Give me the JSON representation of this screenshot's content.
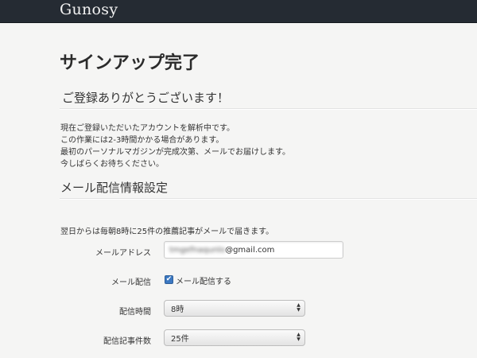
{
  "header": {
    "brand": "Gunosy"
  },
  "main": {
    "title": "サインアップ完了",
    "welcome": "ご登録ありがとうございます！",
    "intro_lines": [
      "現在ご登録いただいたアカウントを解析中です。",
      "この作業には2-3時間かかる場合があります。",
      "最初のパーソナルマガジンが完成次第、メールでお届けします。",
      "今しばらくお待ちください。"
    ],
    "mail_section_title": "メール配信情報設定",
    "mail_notice": "翌日からは毎朝8時に25件の推薦記事がメールで届きます。"
  },
  "form": {
    "email_label": "メールアドレス",
    "email_value_hidden": "tmgefnaqunlo",
    "email_value_domain": "@gmail.com",
    "delivery_label": "メール配信",
    "delivery_checkbox_label": "メール配信する",
    "delivery_checked": true,
    "time_label": "配信時間",
    "time_value": "8時",
    "count_label": "配信記事件数",
    "count_value": "25件"
  },
  "colors": {
    "topbar": "#252b33",
    "background": "#f5f5f4",
    "checkbox": "#3b78c2"
  }
}
